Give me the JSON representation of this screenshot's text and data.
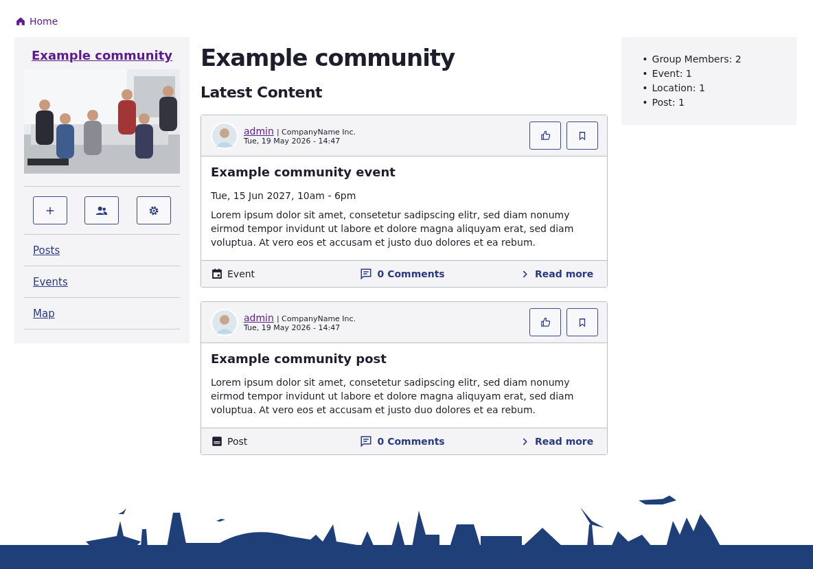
{
  "breadcrumb": {
    "label": "Home"
  },
  "sidebar": {
    "title": "Example community",
    "nav": [
      {
        "label": "Posts"
      },
      {
        "label": "Events"
      },
      {
        "label": "Map"
      }
    ]
  },
  "main": {
    "title": "Example community",
    "subtitle": "Latest Content",
    "posts": [
      {
        "kind": "event",
        "author": "admin",
        "company": "| CompanyName Inc.",
        "date": "Tue, 19 May 2026 - 14:47",
        "title": "Example community event",
        "event_date": "Tue, 15 Jun 2027, 10am - 6pm",
        "body": "Lorem ipsum dolor sit amet, consetetur sadipscing elitr, sed diam nonumy eirmod tempor invidunt ut labore et dolore magna aliquyam erat, sed diam voluptua. At vero eos et accusam et justo duo dolores et ea rebum.",
        "type_label": "Event",
        "comments": "0 Comments",
        "read_more": "Read more"
      },
      {
        "kind": "post",
        "author": "admin",
        "company": "| CompanyName Inc.",
        "date": "Tue, 19 May 2026 - 14:47",
        "title": "Example community post",
        "body": "Lorem ipsum dolor sit amet, consetetur sadipscing elitr, sed diam nonumy eirmod tempor invidunt ut labore et dolore magna aliquyam erat, sed diam voluptua. At vero eos et accusam et justo duo dolores et ea rebum.",
        "type_label": "Post",
        "comments": "0 Comments",
        "read_more": "Read more"
      }
    ]
  },
  "stats": [
    {
      "bullet": "•",
      "text": "Group Members: 2"
    },
    {
      "bullet": "•",
      "text": "Event: 1"
    },
    {
      "bullet": "•",
      "text": "Location: 1"
    },
    {
      "bullet": "•",
      "text": "Post: 1"
    }
  ]
}
